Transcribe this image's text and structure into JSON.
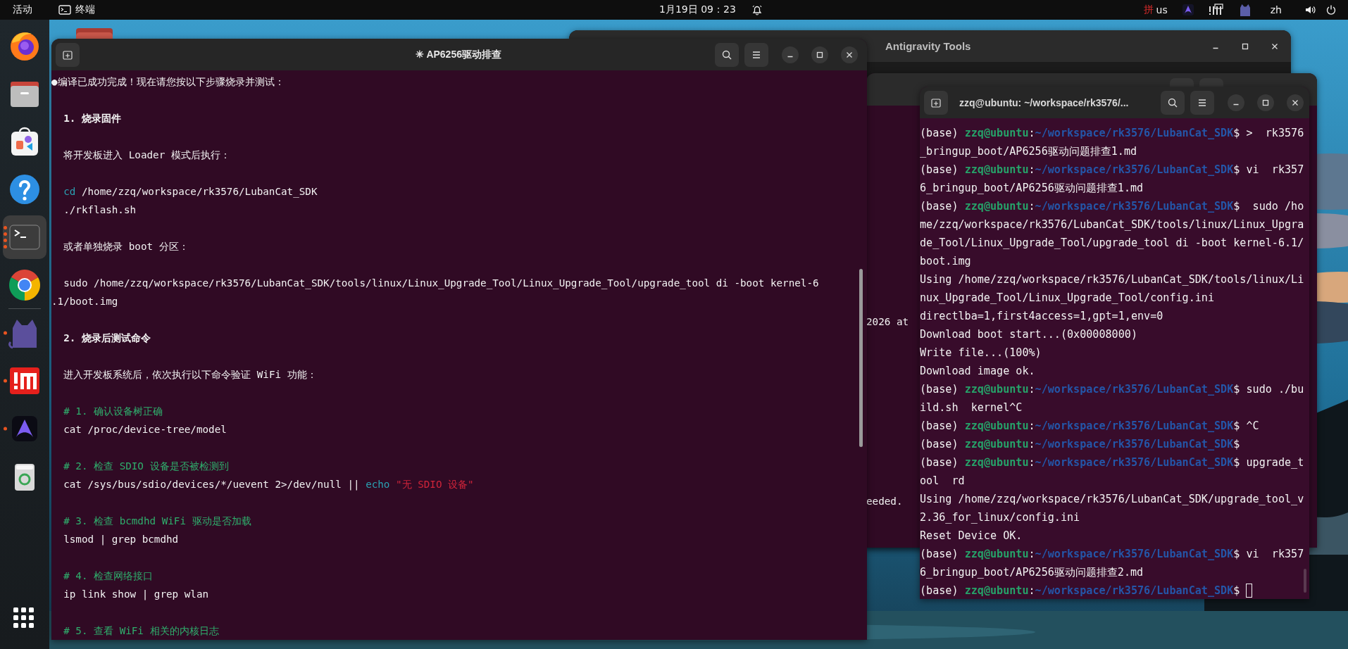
{
  "top_bar": {
    "activities": "活动",
    "app_menu": "终端",
    "clock": "1月19日 09：23",
    "input_method": "拼",
    "keyboard_layout": "us",
    "language": "zh"
  },
  "dock": {
    "pinned": [
      {
        "kind": "firefox",
        "running": false,
        "focused": false
      },
      {
        "kind": "files",
        "running": false,
        "focused": false
      },
      {
        "kind": "store",
        "running": false,
        "focused": false
      },
      {
        "kind": "help",
        "running": false,
        "focused": false
      },
      {
        "kind": "terminal",
        "running": true,
        "many_windows": true,
        "focused": true
      },
      {
        "kind": "chrome",
        "running": false,
        "focused": false
      }
    ],
    "others": [
      {
        "kind": "cat",
        "running": true,
        "many_windows": false,
        "focused": false
      },
      {
        "kind": "monitor",
        "running": true,
        "many_windows": false,
        "focused": false
      },
      {
        "kind": "antigravity",
        "running": true,
        "many_windows": false,
        "focused": false
      },
      {
        "kind": "trash",
        "running": false,
        "focused": false
      }
    ]
  },
  "windows": [
    {
      "kind": "app",
      "title": "Antigravity Tools"
    },
    {
      "kind": "terminal-back",
      "lines": [
        {
          "kind": "plain",
          "text": "2026 at"
        },
        {
          "kind": "plain",
          "text": "eeded."
        }
      ]
    },
    {
      "kind": "terminal",
      "title": "✳ AP6256驱动排查",
      "lines": [
        {
          "kind": "plain",
          "text": "●编译已成功完成！现在请您按以下步骤烧录并测试："
        },
        {
          "kind": "blank"
        },
        {
          "kind": "heading",
          "text": "  1. 烧录固件"
        },
        {
          "kind": "blank"
        },
        {
          "kind": "plain",
          "text": "  将开发板进入 Loader 模式后执行："
        },
        {
          "kind": "blank"
        },
        {
          "kind": "mixed",
          "segments": [
            {
              "kind": "keyword",
              "text": "  cd"
            },
            {
              "kind": "plain",
              "text": " /home/zzq/workspace/rk3576/LubanCat_SDK"
            }
          ]
        },
        {
          "kind": "plain",
          "text": "  ./rkflash.sh"
        },
        {
          "kind": "blank"
        },
        {
          "kind": "plain",
          "text": "  或者单独烧录 boot 分区："
        },
        {
          "kind": "blank"
        },
        {
          "kind": "plain",
          "text": "  sudo /home/zzq/workspace/rk3576/LubanCat_SDK/tools/linux/Linux_Upgrade_Tool/Linux_Upgrade_Tool/upgrade_tool di -boot kernel-6"
        },
        {
          "kind": "plain",
          "text": ".1/boot.img"
        },
        {
          "kind": "blank"
        },
        {
          "kind": "heading",
          "text": "  2. 烧录后测试命令"
        },
        {
          "kind": "blank"
        },
        {
          "kind": "plain",
          "text": "  进入开发板系统后，依次执行以下命令验证 WiFi 功能："
        },
        {
          "kind": "blank"
        },
        {
          "kind": "comment",
          "text": "  # 1. 确认设备树正确"
        },
        {
          "kind": "plain",
          "text": "  cat /proc/device-tree/model"
        },
        {
          "kind": "blank"
        },
        {
          "kind": "comment",
          "text": "  # 2. 检查 SDIO 设备是否被检测到"
        },
        {
          "kind": "mixed",
          "segments": [
            {
              "kind": "plain",
              "text": "  cat /sys/bus/sdio/devices/*/uevent 2>/dev/null || "
            },
            {
              "kind": "keyword",
              "text": "echo"
            },
            {
              "kind": "string",
              "text": " \"无 SDIO 设备\""
            }
          ]
        },
        {
          "kind": "blank"
        },
        {
          "kind": "comment",
          "text": "  # 3. 检查 bcmdhd WiFi 驱动是否加载"
        },
        {
          "kind": "plain",
          "text": "  lsmod | grep bcmdhd"
        },
        {
          "kind": "blank"
        },
        {
          "kind": "comment",
          "text": "  # 4. 检查网络接口"
        },
        {
          "kind": "plain",
          "text": "  ip link show | grep wlan"
        },
        {
          "kind": "blank"
        },
        {
          "kind": "comment",
          "text": "  # 5. 查看 WiFi 相关的内核日志"
        }
      ]
    },
    {
      "kind": "terminal",
      "title": "zzq@ubuntu: ~/workspace/rk3576/...",
      "lines": [
        {
          "kind": "mixed",
          "segments": [
            {
              "kind": "plain",
              "text": "(base) "
            },
            {
              "kind": "user",
              "text": "zzq@ubuntu"
            },
            {
              "kind": "plain",
              "text": ":"
            },
            {
              "kind": "path",
              "text": "~/workspace/rk3576/LubanCat_SDK"
            },
            {
              "kind": "plain",
              "text": "$ >  rk3576"
            }
          ]
        },
        {
          "kind": "plain",
          "text": "_bringup_boot/AP6256驱动问题排查1.md"
        },
        {
          "kind": "mixed",
          "segments": [
            {
              "kind": "plain",
              "text": "(base) "
            },
            {
              "kind": "user",
              "text": "zzq@ubuntu"
            },
            {
              "kind": "plain",
              "text": ":"
            },
            {
              "kind": "path",
              "text": "~/workspace/rk3576/LubanCat_SDK"
            },
            {
              "kind": "plain",
              "text": "$ vi  rk357"
            }
          ]
        },
        {
          "kind": "plain",
          "text": "6_bringup_boot/AP6256驱动问题排查1.md"
        },
        {
          "kind": "mixed",
          "segments": [
            {
              "kind": "plain",
              "text": "(base) "
            },
            {
              "kind": "user",
              "text": "zzq@ubuntu"
            },
            {
              "kind": "plain",
              "text": ":"
            },
            {
              "kind": "path",
              "text": "~/workspace/rk3576/LubanCat_SDK"
            },
            {
              "kind": "plain",
              "text": "$  sudo /ho"
            }
          ]
        },
        {
          "kind": "plain",
          "text": "me/zzq/workspace/rk3576/LubanCat_SDK/tools/linux/Linux_Upgra"
        },
        {
          "kind": "plain",
          "text": "de_Tool/Linux_Upgrade_Tool/upgrade_tool di -boot kernel-6.1/"
        },
        {
          "kind": "plain",
          "text": "boot.img"
        },
        {
          "kind": "plain",
          "text": "Using /home/zzq/workspace/rk3576/LubanCat_SDK/tools/linux/Li"
        },
        {
          "kind": "plain",
          "text": "nux_Upgrade_Tool/Linux_Upgrade_Tool/config.ini"
        },
        {
          "kind": "plain",
          "text": "directlba=1,first4access=1,gpt=1,env=0"
        },
        {
          "kind": "plain",
          "text": "Download boot start...(0x00008000)"
        },
        {
          "kind": "plain",
          "text": "Write file...(100%)"
        },
        {
          "kind": "plain",
          "text": "Download image ok."
        },
        {
          "kind": "mixed",
          "segments": [
            {
              "kind": "plain",
              "text": "(base) "
            },
            {
              "kind": "user",
              "text": "zzq@ubuntu"
            },
            {
              "kind": "plain",
              "text": ":"
            },
            {
              "kind": "path",
              "text": "~/workspace/rk3576/LubanCat_SDK"
            },
            {
              "kind": "plain",
              "text": "$ sudo ./bu"
            }
          ]
        },
        {
          "kind": "plain",
          "text": "ild.sh  kernel^C"
        },
        {
          "kind": "mixed",
          "segments": [
            {
              "kind": "plain",
              "text": "(base) "
            },
            {
              "kind": "user",
              "text": "zzq@ubuntu"
            },
            {
              "kind": "plain",
              "text": ":"
            },
            {
              "kind": "path",
              "text": "~/workspace/rk3576/LubanCat_SDK"
            },
            {
              "kind": "plain",
              "text": "$ ^C"
            }
          ]
        },
        {
          "kind": "mixed",
          "segments": [
            {
              "kind": "plain",
              "text": "(base) "
            },
            {
              "kind": "user",
              "text": "zzq@ubuntu"
            },
            {
              "kind": "plain",
              "text": ":"
            },
            {
              "kind": "path",
              "text": "~/workspace/rk3576/LubanCat_SDK"
            },
            {
              "kind": "plain",
              "text": "$"
            }
          ]
        },
        {
          "kind": "mixed",
          "segments": [
            {
              "kind": "plain",
              "text": "(base) "
            },
            {
              "kind": "user",
              "text": "zzq@ubuntu"
            },
            {
              "kind": "plain",
              "text": ":"
            },
            {
              "kind": "path",
              "text": "~/workspace/rk3576/LubanCat_SDK"
            },
            {
              "kind": "plain",
              "text": "$ upgrade_t"
            }
          ]
        },
        {
          "kind": "plain",
          "text": "ool  rd"
        },
        {
          "kind": "plain",
          "text": "Using /home/zzq/workspace/rk3576/LubanCat_SDK/upgrade_tool_v"
        },
        {
          "kind": "plain",
          "text": "2.36_for_linux/config.ini"
        },
        {
          "kind": "plain",
          "text": "Reset Device OK."
        },
        {
          "kind": "mixed",
          "segments": [
            {
              "kind": "plain",
              "text": "(base) "
            },
            {
              "kind": "user",
              "text": "zzq@ubuntu"
            },
            {
              "kind": "plain",
              "text": ":"
            },
            {
              "kind": "path",
              "text": "~/workspace/rk3576/LubanCat_SDK"
            },
            {
              "kind": "plain",
              "text": "$ vi  rk357"
            }
          ]
        },
        {
          "kind": "plain",
          "text": "6_bringup_boot/AP6256驱动问题排查2.md"
        },
        {
          "kind": "mixed",
          "cursor": true,
          "segments": [
            {
              "kind": "plain",
              "text": "(base) "
            },
            {
              "kind": "user",
              "text": "zzq@ubuntu"
            },
            {
              "kind": "plain",
              "text": ":"
            },
            {
              "kind": "path",
              "text": "~/workspace/rk3576/LubanCat_SDK"
            },
            {
              "kind": "plain",
              "text": "$"
            }
          ]
        }
      ]
    }
  ]
}
